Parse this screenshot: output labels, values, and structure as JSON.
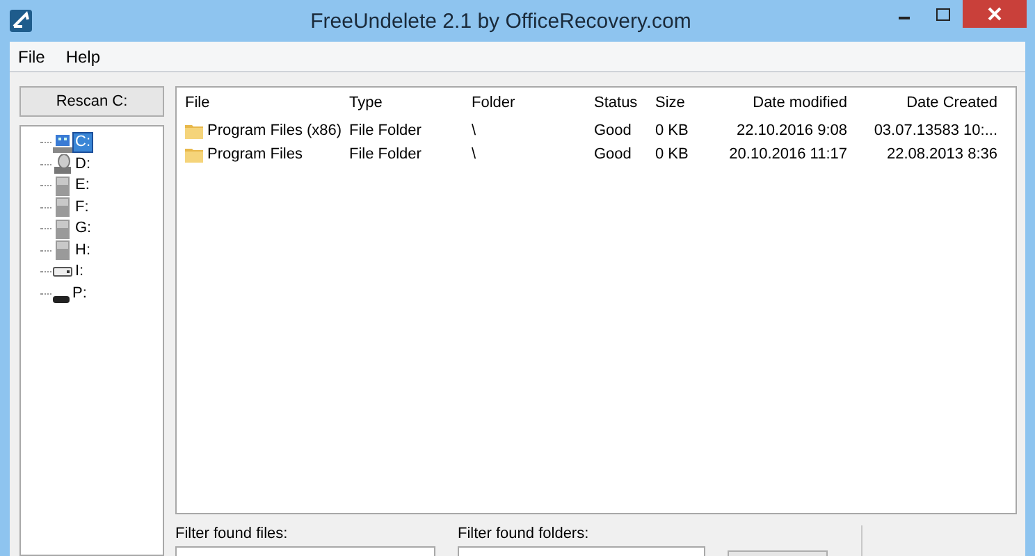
{
  "window": {
    "title": "FreeUndelete 2.1 by OfficeRecovery.com"
  },
  "menu": [
    "File",
    "Help"
  ],
  "rescan_button": "Rescan C:",
  "drives": [
    {
      "label": "C:",
      "kind": "computer",
      "selected": true
    },
    {
      "label": "D:",
      "kind": "optical",
      "selected": false
    },
    {
      "label": "E:",
      "kind": "disk",
      "selected": false
    },
    {
      "label": "F:",
      "kind": "disk",
      "selected": false
    },
    {
      "label": "G:",
      "kind": "disk",
      "selected": false
    },
    {
      "label": "H:",
      "kind": "disk",
      "selected": false
    },
    {
      "label": "I:",
      "kind": "usb",
      "selected": false
    },
    {
      "label": "P:",
      "kind": "card",
      "selected": false
    }
  ],
  "table": {
    "columns": [
      "File",
      "Type",
      "Folder",
      "Status",
      "Size",
      "Date modified",
      "Date Created"
    ],
    "rows": [
      [
        "Program Files (x86)",
        "File Folder",
        "\\",
        "Good",
        "0 KB",
        "22.10.2016  9:08",
        "03.07.13583 10:..."
      ],
      [
        "Program Files",
        "File Folder",
        "\\",
        "Good",
        "0 KB",
        "20.10.2016 11:17",
        "22.08.2013  8:36"
      ]
    ]
  },
  "filters": [
    {
      "label": "Filter found files:"
    },
    {
      "label": "Filter found folders:"
    }
  ]
}
